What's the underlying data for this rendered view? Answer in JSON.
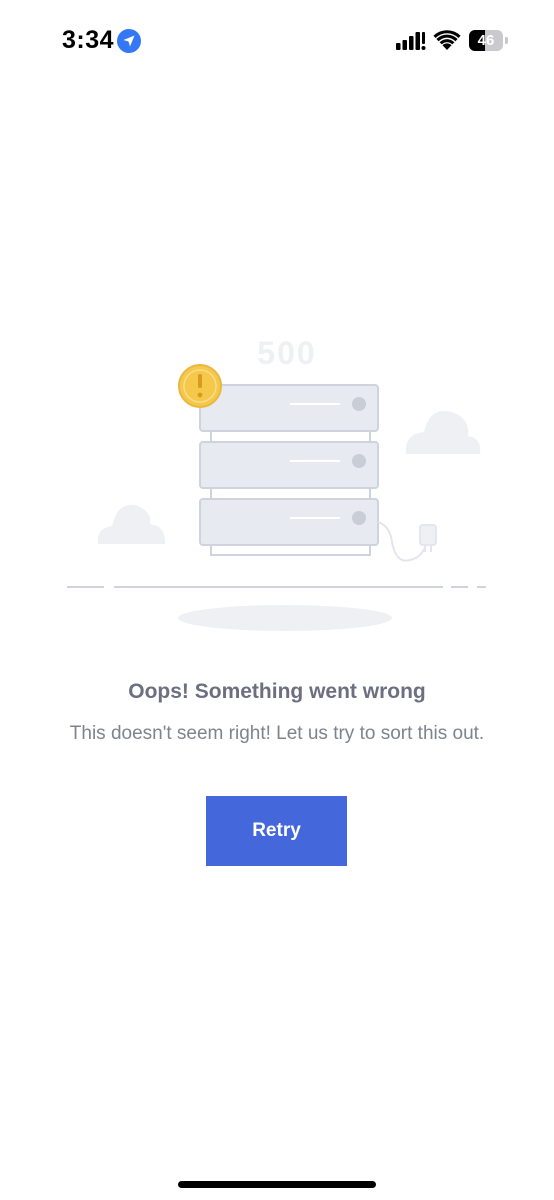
{
  "status_bar": {
    "time": "3:34",
    "battery_level": "46",
    "battery_fraction": 0.46,
    "icons": [
      "location-arrow-icon",
      "cellular-signal-icon",
      "wifi-icon",
      "battery-icon"
    ]
  },
  "illustration": {
    "error_code": "500",
    "icons": [
      "server-rack-icon",
      "warning-badge-icon",
      "cloud-icon",
      "power-plug-icon"
    ]
  },
  "error": {
    "title": "Oops! Something went wrong",
    "message": "This doesn't seem right! Let us try to sort this out."
  },
  "actions": {
    "retry_label": "Retry"
  },
  "colors": {
    "accent": "#4468db",
    "title": "#6b6f80",
    "body": "#80838f",
    "warning": "#f5c84a",
    "illustration_line": "#cfd3de",
    "illustration_fill": "#e8eaf1"
  }
}
